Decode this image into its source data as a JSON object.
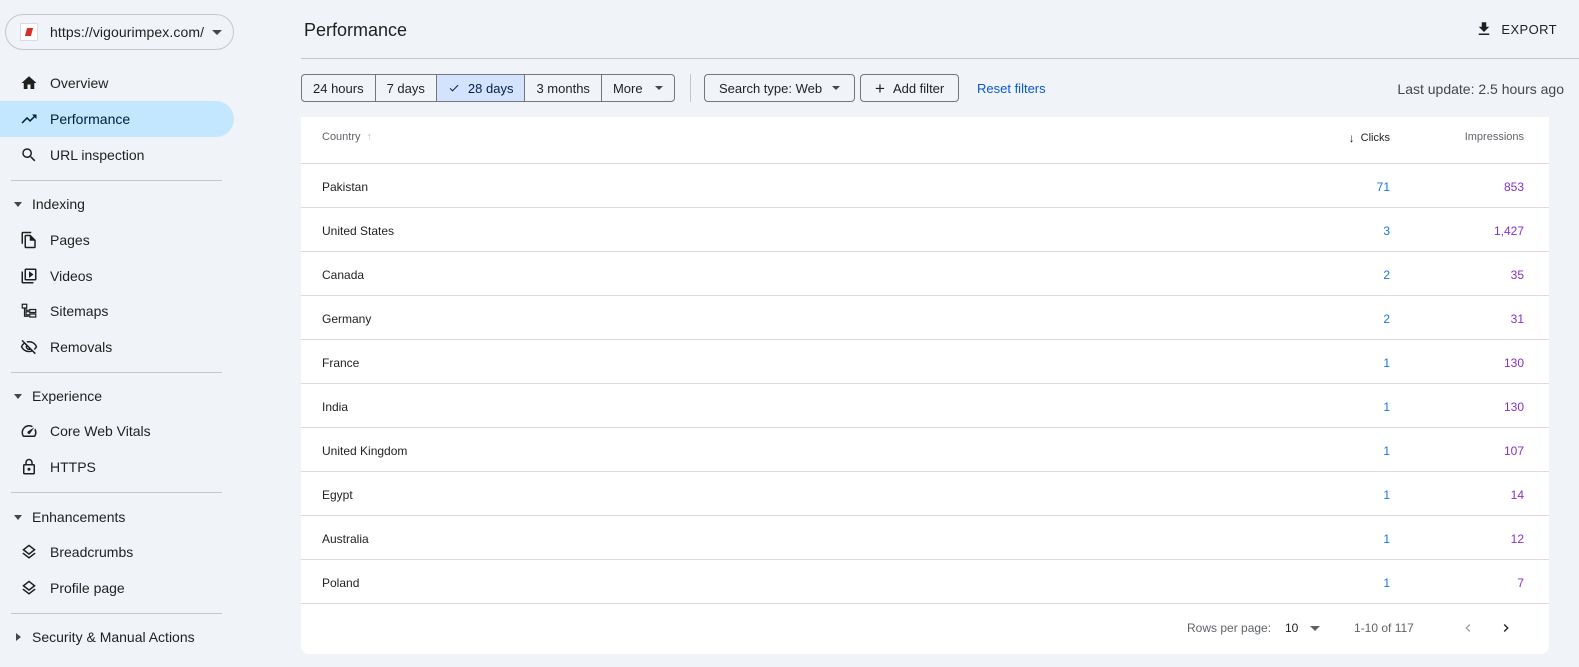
{
  "property": {
    "url": "https://vigourimpex.com/"
  },
  "nav": {
    "overview": "Overview",
    "performance": "Performance",
    "url_inspection": "URL inspection",
    "indexing": "Indexing",
    "pages": "Pages",
    "videos": "Videos",
    "sitemaps": "Sitemaps",
    "removals": "Removals",
    "experience": "Experience",
    "core_web_vitals": "Core Web Vitals",
    "https": "HTTPS",
    "enhancements": "Enhancements",
    "breadcrumbs": "Breadcrumbs",
    "profile_page": "Profile page",
    "security": "Security & Manual Actions"
  },
  "header": {
    "title": "Performance",
    "export": "EXPORT"
  },
  "filters": {
    "ranges": [
      "24 hours",
      "7 days",
      "28 days",
      "3 months"
    ],
    "more": "More",
    "search_type": "Search type: Web",
    "add_filter": "Add filter",
    "reset": "Reset filters",
    "last_update": "Last update: 2.5 hours ago"
  },
  "table": {
    "headers": {
      "country": "Country",
      "clicks": "Clicks",
      "impressions": "Impressions"
    },
    "rows": [
      {
        "country": "Pakistan",
        "clicks": "71",
        "impressions": "853"
      },
      {
        "country": "United States",
        "clicks": "3",
        "impressions": "1,427"
      },
      {
        "country": "Canada",
        "clicks": "2",
        "impressions": "35"
      },
      {
        "country": "Germany",
        "clicks": "2",
        "impressions": "31"
      },
      {
        "country": "France",
        "clicks": "1",
        "impressions": "130"
      },
      {
        "country": "India",
        "clicks": "1",
        "impressions": "130"
      },
      {
        "country": "United Kingdom",
        "clicks": "1",
        "impressions": "107"
      },
      {
        "country": "Egypt",
        "clicks": "1",
        "impressions": "14"
      },
      {
        "country": "Australia",
        "clicks": "1",
        "impressions": "12"
      },
      {
        "country": "Poland",
        "clicks": "1",
        "impressions": "7"
      }
    ]
  },
  "pager": {
    "rows_per_page_label": "Rows per page:",
    "rows_per_page": "10",
    "range": "1-10 of 117"
  },
  "colors": {
    "accent": "#c2e7ff",
    "clicks": "#1a73e8",
    "impressions": "#8430ce",
    "link": "#0b57d0"
  }
}
